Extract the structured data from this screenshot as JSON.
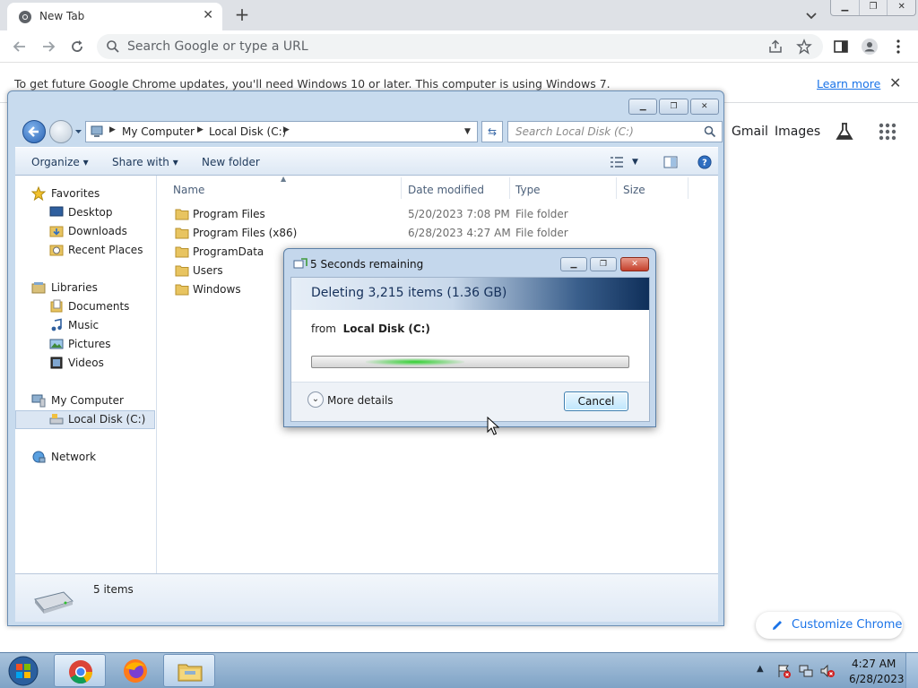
{
  "browser": {
    "tab_title": "New Tab",
    "omnibox_placeholder": "Search Google or type a URL",
    "infobar_text": "To get future Google Chrome updates, you'll need Windows 10 or later. This computer is using Windows 7.",
    "infobar_link": "Learn more",
    "ntp_links": {
      "gmail": "Gmail",
      "images": "Images"
    },
    "customize_label": "Customize Chrome"
  },
  "explorer": {
    "breadcrumb": [
      "My Computer",
      "Local Disk (C:)"
    ],
    "search_placeholder": "Search Local Disk (C:)",
    "commands": {
      "organize": "Organize",
      "share_with": "Share with",
      "new_folder": "New folder"
    },
    "nav": {
      "favorites": "Favorites",
      "desktop": "Desktop",
      "downloads": "Downloads",
      "recent_places": "Recent Places",
      "libraries": "Libraries",
      "documents": "Documents",
      "music": "Music",
      "pictures": "Pictures",
      "videos": "Videos",
      "my_computer": "My Computer",
      "local_disk": "Local Disk (C:)",
      "network": "Network"
    },
    "columns": {
      "name": "Name",
      "date_modified": "Date modified",
      "type": "Type",
      "size": "Size"
    },
    "files": [
      {
        "name": "Program Files",
        "date": "5/20/2023 7:08 PM",
        "type": "File folder"
      },
      {
        "name": "Program Files (x86)",
        "date": "6/28/2023 4:27 AM",
        "type": "File folder"
      },
      {
        "name": "ProgramData",
        "date": "",
        "type": ""
      },
      {
        "name": "Users",
        "date": "",
        "type": ""
      },
      {
        "name": "Windows",
        "date": "",
        "type": ""
      }
    ],
    "status": "5 items"
  },
  "dialog": {
    "title": "5 Seconds remaining",
    "heading": "Deleting 3,215 items (1.36 GB)",
    "from_prefix": "from",
    "from_location": "Local Disk (C:)",
    "more_details": "More details",
    "cancel": "Cancel"
  },
  "taskbar": {
    "time": "4:27 AM",
    "date": "6/28/2023"
  }
}
